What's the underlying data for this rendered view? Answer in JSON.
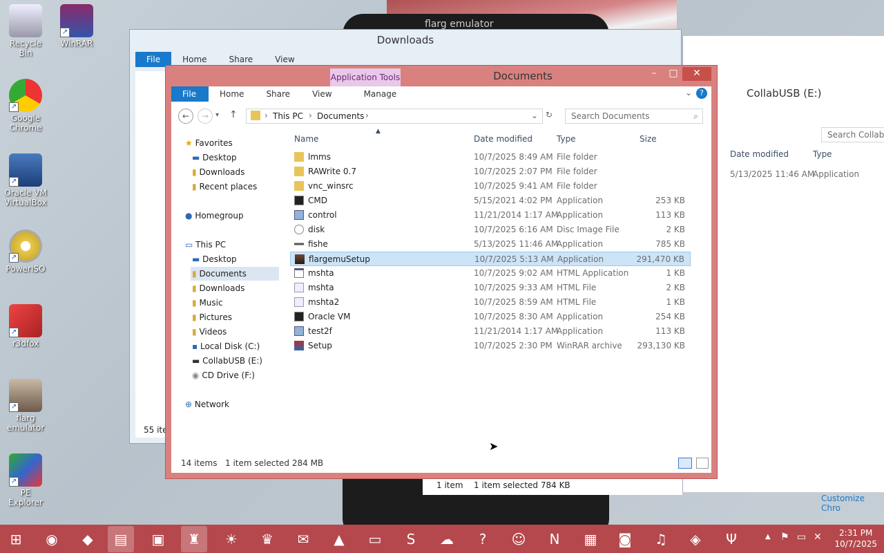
{
  "desktop": {
    "icons": [
      {
        "label": "Recycle Bin"
      },
      {
        "label": "WinRAR"
      },
      {
        "label": "Google Chrome"
      },
      {
        "label": "Oracle VM VirtualBox"
      },
      {
        "label": "PowerISO"
      },
      {
        "label": "r3dfox"
      },
      {
        "label": "flarg emulator"
      },
      {
        "label": "PE Explorer"
      }
    ]
  },
  "emulator": {
    "title": "flarg emulator"
  },
  "downloads_window": {
    "title": "Downloads",
    "tabs": [
      "File",
      "Home",
      "Share",
      "View"
    ],
    "status": "55 ite"
  },
  "usb_window": {
    "title": "CollabUSB (E:)",
    "search_placeholder": "Search CollabUS",
    "columns": [
      "Date modified",
      "Type"
    ],
    "row": {
      "date": "5/13/2025 11:46 AM",
      "type": "Application"
    },
    "status_count": "1 item",
    "status_sel": "1 item selected  784 KB",
    "customize": "Customize Chro"
  },
  "documents_window": {
    "context_tab": "Application Tools",
    "title": "Documents",
    "tabs": [
      "File",
      "Home",
      "Share",
      "View",
      "Manage"
    ],
    "breadcrumb": [
      "This PC",
      "Documents"
    ],
    "search_placeholder": "Search Documents",
    "nav": {
      "favorites": "Favorites",
      "fav_items": [
        "Desktop",
        "Downloads",
        "Recent places"
      ],
      "homegroup": "Homegroup",
      "thispc": "This PC",
      "pc_items": [
        "Desktop",
        "Documents",
        "Downloads",
        "Music",
        "Pictures",
        "Videos",
        "Local Disk (C:)",
        "CollabUSB (E:)",
        "CD Drive (F:)"
      ],
      "network": "Network"
    },
    "columns": {
      "name": "Name",
      "date": "Date modified",
      "type": "Type",
      "size": "Size"
    },
    "files": [
      {
        "name": "lmms",
        "date": "10/7/2025 8:49 AM",
        "type": "File folder",
        "size": "",
        "icon": "folder-icon"
      },
      {
        "name": "RAWrite 0.7",
        "date": "10/7/2025 2:07 PM",
        "type": "File folder",
        "size": "",
        "icon": "folder-icon"
      },
      {
        "name": "vnc_winsrc",
        "date": "10/7/2025 9:41 AM",
        "type": "File folder",
        "size": "",
        "icon": "folder-icon"
      },
      {
        "name": "CMD",
        "date": "5/15/2021 4:02 PM",
        "type": "Application",
        "size": "253 KB",
        "icon": "cmd-icon"
      },
      {
        "name": "control",
        "date": "11/21/2014 1:17 AM",
        "type": "Application",
        "size": "113 KB",
        "icon": "control-icon"
      },
      {
        "name": "disk",
        "date": "10/7/2025 6:16 AM",
        "type": "Disc Image File",
        "size": "2 KB",
        "icon": "disc-icon"
      },
      {
        "name": "fishe",
        "date": "5/13/2025 11:46 AM",
        "type": "Application",
        "size": "785 KB",
        "icon": "app-icon"
      },
      {
        "name": "flargemuSetup",
        "date": "10/7/2025 5:13 AM",
        "type": "Application",
        "size": "291,470 KB",
        "icon": "setup-icon"
      },
      {
        "name": "mshta",
        "date": "10/7/2025 9:02 AM",
        "type": "HTML Application",
        "size": "1 KB",
        "icon": "hta-icon"
      },
      {
        "name": "mshta",
        "date": "10/7/2025 9:33 AM",
        "type": "HTML File",
        "size": "2 KB",
        "icon": "html-icon"
      },
      {
        "name": "mshta2",
        "date": "10/7/2025 8:59 AM",
        "type": "HTML File",
        "size": "1 KB",
        "icon": "html-icon"
      },
      {
        "name": "Oracle VM",
        "date": "10/7/2025 8:30 AM",
        "type": "Application",
        "size": "254 KB",
        "icon": "cmd-icon"
      },
      {
        "name": "test2f",
        "date": "11/21/2014 1:17 AM",
        "type": "Application",
        "size": "113 KB",
        "icon": "control-icon"
      },
      {
        "name": "Setup",
        "date": "10/7/2025 2:30 PM",
        "type": "WinRAR archive",
        "size": "293,130 KB",
        "icon": "rar-icon"
      }
    ],
    "status_count": "14 items",
    "status_sel": "1 item selected  284 MB"
  },
  "taskbar": {
    "time": "2:31 PM",
    "date": "10/7/2025"
  },
  "colors": {
    "accent": "#1979ca",
    "window_border": "#d9817f",
    "taskbar": "#b5484d"
  }
}
